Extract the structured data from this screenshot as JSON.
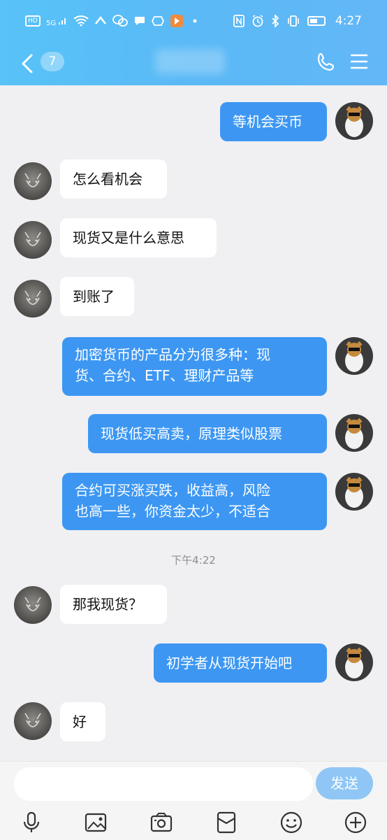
{
  "status_bar": {
    "left_icons": [
      "hd-icon",
      "signal-5g-icon",
      "wifi-icon",
      "app-notification-icon",
      "wechat-icon",
      "message-icon",
      "app-icon",
      "video-app-icon",
      "more-dots-icon"
    ],
    "left_labels": {
      "hd": "HD",
      "signal": "5G"
    },
    "right_icons": [
      "nfc-icon",
      "alarm-icon",
      "bluetooth-icon",
      "vibrate-icon",
      "battery-icon"
    ],
    "time": "4:27"
  },
  "nav": {
    "unread_count": "7",
    "title_blurred": true
  },
  "messages": [
    {
      "side": "right",
      "text": "等机会买币"
    },
    {
      "side": "left",
      "text": "怎么看机会"
    },
    {
      "side": "left",
      "text": "现货又是什么意思"
    },
    {
      "side": "left",
      "text": "到账了"
    },
    {
      "side": "right",
      "lines": [
        "加密货币的产品分为很多种：现",
        "货、合约、ETF、理财产品等"
      ]
    },
    {
      "side": "right",
      "text": "现货低买高卖，原理类似股票"
    },
    {
      "side": "right",
      "lines": [
        "合约可买涨买跌，收益高，风险",
        "也高一些，你资金太少，不适合"
      ]
    },
    {
      "side": "time",
      "text": "下午4:22"
    },
    {
      "side": "left",
      "text": "那我现货？"
    },
    {
      "side": "right",
      "text": "初学者从现货开始吧"
    },
    {
      "side": "left",
      "text": "好"
    }
  ],
  "composer": {
    "input_value": "",
    "send_label": "发送",
    "toolbar_icons": [
      "microphone-icon",
      "image-icon",
      "camera-icon",
      "red-packet-icon",
      "emoji-icon",
      "plus-icon"
    ]
  },
  "colors": {
    "header": "#5ab9f6",
    "outgoing_bubble": "#3d97f2",
    "incoming_bubble": "#ffffff",
    "send_button": "#8fc6f5"
  }
}
